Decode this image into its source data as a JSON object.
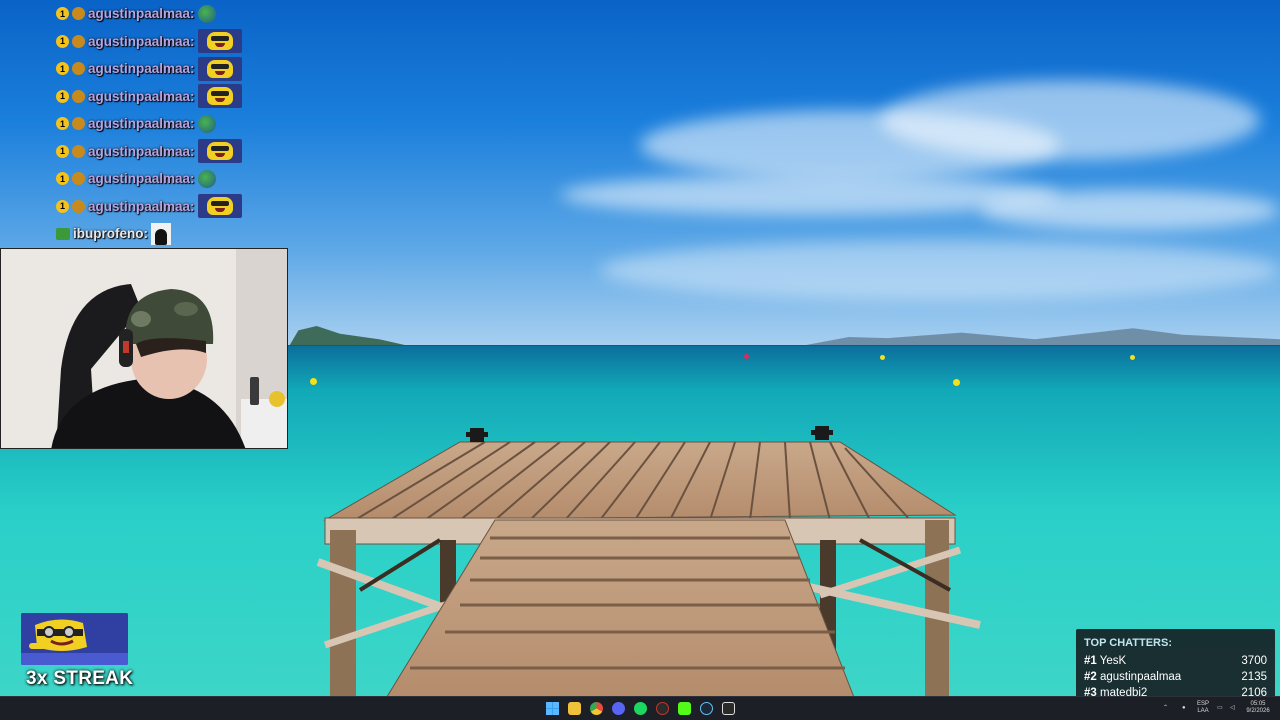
{
  "chat": {
    "messages": [
      {
        "user": "agustinpaalmaa:",
        "emote": "small",
        "style": "plain"
      },
      {
        "user": "agustinpaalmaa:",
        "emote": "big",
        "style": "sub"
      },
      {
        "user": "agustinpaalmaa:",
        "emote": "big",
        "style": "sub"
      },
      {
        "user": "agustinpaalmaa:",
        "emote": "big",
        "style": "sub"
      },
      {
        "user": "agustinpaalmaa:",
        "emote": "small",
        "style": "sub"
      },
      {
        "user": "agustinpaalmaa:",
        "emote": "big",
        "style": "sub"
      },
      {
        "user": "agustinpaalmaa:",
        "emote": "small",
        "style": "sub"
      },
      {
        "user": "agustinpaalmaa:",
        "emote": "big",
        "style": "sub"
      },
      {
        "user": "ibuprofeno:",
        "emote": "face",
        "style": "alt"
      }
    ],
    "badge_one": "1"
  },
  "streak": {
    "label": "3x STREAK"
  },
  "top_chatters": {
    "title": "TOP CHATTERS:",
    "rows": [
      {
        "rank": "#1",
        "name": "YesK",
        "count": "3700"
      },
      {
        "rank": "#2",
        "name": "agustinpaalmaa",
        "count": "2135"
      },
      {
        "rank": "#3",
        "name": "matedbi2",
        "count": "2106"
      }
    ]
  },
  "taskbar": {
    "language": "ESP",
    "layout": "LAA",
    "time": "05:05",
    "date": "9/2/2026"
  },
  "colors": {
    "chat_name": "#b8a3e0",
    "chatters_bg": "#14181c",
    "taskbar_bg": "#1c1f26"
  }
}
